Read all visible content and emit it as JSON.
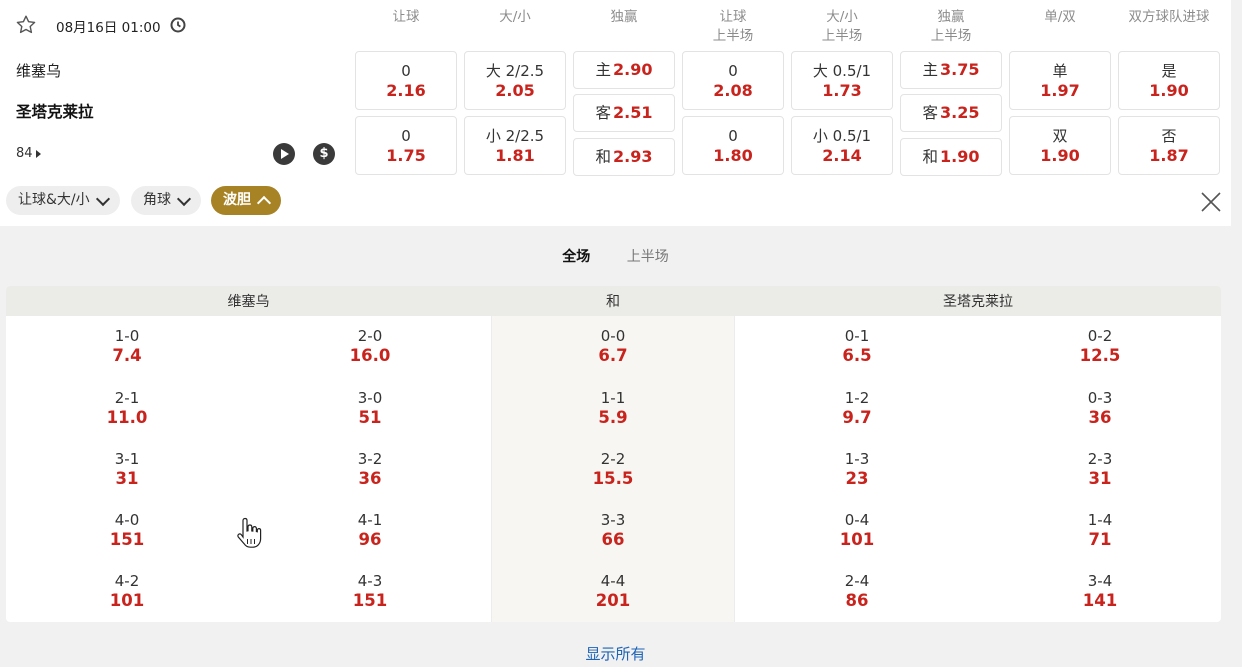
{
  "match": {
    "datetime": "08月16日 01:00",
    "team_home": "维塞乌",
    "team_away": "圣塔克莱拉",
    "minute": "84"
  },
  "columns": [
    {
      "line1": "让球",
      "line2": ""
    },
    {
      "line1": "大/小",
      "line2": ""
    },
    {
      "line1": "独赢",
      "line2": ""
    },
    {
      "line1": "让球",
      "line2": "上半场"
    },
    {
      "line1": "大/小",
      "line2": "上半场"
    },
    {
      "line1": "独赢",
      "line2": "上半场"
    },
    {
      "line1": "单/双",
      "line2": ""
    },
    {
      "line1": "双方球队进球",
      "line2": ""
    }
  ],
  "odds": {
    "handicap": [
      {
        "line": "0",
        "odd": "2.16"
      },
      {
        "line": "0",
        "odd": "1.75"
      }
    ],
    "overunder": [
      {
        "line": "大 2/2.5",
        "odd": "2.05"
      },
      {
        "line": "小 2/2.5",
        "odd": "1.81"
      }
    ],
    "moneyline": [
      {
        "label": "主",
        "odd": "2.90"
      },
      {
        "label": "客",
        "odd": "2.51"
      },
      {
        "label": "和",
        "odd": "2.93"
      }
    ],
    "handicap_1h": [
      {
        "line": "0",
        "odd": "2.08"
      },
      {
        "line": "0",
        "odd": "1.80"
      }
    ],
    "overunder_1h": [
      {
        "line": "大 0.5/1",
        "odd": "1.73"
      },
      {
        "line": "小 0.5/1",
        "odd": "2.14"
      }
    ],
    "moneyline_1h": [
      {
        "label": "主",
        "odd": "3.75"
      },
      {
        "label": "客",
        "odd": "3.25"
      },
      {
        "label": "和",
        "odd": "1.90"
      }
    ],
    "oddeven": [
      {
        "line": "单",
        "odd": "1.97"
      },
      {
        "line": "双",
        "odd": "1.90"
      }
    ],
    "btts": [
      {
        "line": "是",
        "odd": "1.90"
      },
      {
        "line": "否",
        "odd": "1.87"
      }
    ]
  },
  "filters": {
    "pill1": "让球&大/小",
    "pill2": "角球",
    "pill3": "波胆"
  },
  "period_tabs": {
    "full": "全场",
    "half": "上半场"
  },
  "correct_score": {
    "headers": {
      "home": "维塞乌",
      "draw": "和",
      "away": "圣塔克莱拉"
    },
    "rows": [
      [
        {
          "score": "1-0",
          "odd": "7.4"
        },
        {
          "score": "2-0",
          "odd": "16.0"
        },
        {
          "score": "0-0",
          "odd": "6.7"
        },
        {
          "score": "0-1",
          "odd": "6.5"
        },
        {
          "score": "0-2",
          "odd": "12.5"
        }
      ],
      [
        {
          "score": "2-1",
          "odd": "11.0"
        },
        {
          "score": "3-0",
          "odd": "51"
        },
        {
          "score": "1-1",
          "odd": "5.9"
        },
        {
          "score": "1-2",
          "odd": "9.7"
        },
        {
          "score": "0-3",
          "odd": "36"
        }
      ],
      [
        {
          "score": "3-1",
          "odd": "31"
        },
        {
          "score": "3-2",
          "odd": "36"
        },
        {
          "score": "2-2",
          "odd": "15.5"
        },
        {
          "score": "1-3",
          "odd": "23"
        },
        {
          "score": "2-3",
          "odd": "31"
        }
      ],
      [
        {
          "score": "4-0",
          "odd": "151"
        },
        {
          "score": "4-1",
          "odd": "96"
        },
        {
          "score": "3-3",
          "odd": "66"
        },
        {
          "score": "0-4",
          "odd": "101"
        },
        {
          "score": "1-4",
          "odd": "71"
        }
      ],
      [
        {
          "score": "4-2",
          "odd": "101"
        },
        {
          "score": "4-3",
          "odd": "151"
        },
        {
          "score": "4-4",
          "odd": "201"
        },
        {
          "score": "2-4",
          "odd": "86"
        },
        {
          "score": "3-4",
          "odd": "141"
        }
      ]
    ]
  },
  "show_all": "显示所有",
  "colors": {
    "odd_red": "#c8231c",
    "active_pill": "#a88325",
    "link_blue": "#1d63b8"
  }
}
